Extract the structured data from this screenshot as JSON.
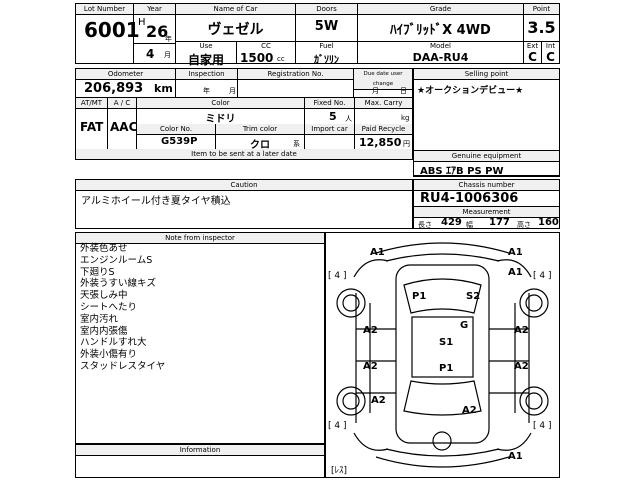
{
  "header": {
    "lot_label": "Lot Number",
    "lot": "6001",
    "year_label": "Year",
    "year_era": "H",
    "year": "26",
    "year_unit": "年",
    "month": "4",
    "month_unit": "月",
    "name_label": "Name of Car",
    "name": "ヴェゼル",
    "use_label": "Use",
    "use": "自家用",
    "cc_label": "CC",
    "cc": "1500",
    "cc_unit": "cc",
    "doors_label": "Doors",
    "doors": "5W",
    "fuel_label": "Fuel",
    "fuel": "ｶﾞｿﾘﾝ",
    "grade_label": "Grade",
    "grade": "ﾊｲﾌﾞﾘｯﾄﾞX 4WD",
    "model_label": "Model",
    "model": "DAA-RU4",
    "point_label": "Point",
    "point": "3.5",
    "ext_label": "Ext",
    "ext": "C",
    "int_label": "Int",
    "int": "C"
  },
  "row2": {
    "odometer_label": "Odometer",
    "odometer": "206,893",
    "odometer_unit": "km",
    "inspection_label": "Inspection",
    "insp_year": "年",
    "insp_month": "月",
    "registration_label": "Registration No.",
    "due_label": "Due date user change",
    "due_month": "月",
    "due_day": "日",
    "selling_label": "Selling point",
    "selling": "★オークションデビュー★"
  },
  "row3": {
    "atmt_label": "AT/MT",
    "atmt": "FAT",
    "ac_label": "A / C",
    "ac": "AAC",
    "color_label": "Color",
    "color": "ミドリ",
    "fixed_label": "Fixed No.",
    "fixed": "5",
    "fixed_unit": "人",
    "maxcarry_label": "Max. Carry",
    "maxcarry_unit": "kg",
    "colorno_label": "Color No.",
    "colorno": "G539P",
    "trim_label": "Trim color",
    "trim": "クロ",
    "import_label": "Import car",
    "import_unit": "系",
    "recycle_label": "Paid Recycle",
    "recycle": "12,850",
    "recycle_unit": "円",
    "items_label": "Item to be sent at a later date",
    "equip_label": "Genuine equipment",
    "equip": "ABS ｴｱB PS PW"
  },
  "caution": {
    "label": "Caution",
    "text": "アルミホイール付き夏タイヤ積込"
  },
  "chassis": {
    "label": "Chassis number",
    "number": "RU4-1006306",
    "meas_label": "Measurement",
    "len_label": "長さ",
    "len": "429",
    "wid_label": "幅",
    "wid": "177",
    "hei_label": "高さ",
    "hei": "160"
  },
  "notes": {
    "label": "Note from inspector",
    "items": [
      "外装色あせ",
      "エンジンルームS",
      "下廻りS",
      "外装うすい線キズ",
      "天張しみ中",
      "シートへたり",
      "室内汚れ",
      "室内内張傷",
      "ハンドルすれ大",
      "外装小傷有り",
      "スタッドレスタイヤ"
    ]
  },
  "information": {
    "label": "Information"
  },
  "diagram": {
    "codes": [
      "A1",
      "A1",
      "A1",
      "P1",
      "S2",
      "A2",
      "G",
      "A2",
      "S1",
      "A2",
      "P1",
      "A2",
      "A2",
      "A2",
      "A1"
    ],
    "tire_marks": [
      "[ 4 ]",
      "[ 4 ]",
      "[ 4 ]",
      "[ 4 ]"
    ],
    "spare_mark": "[ﾚｽ]"
  }
}
